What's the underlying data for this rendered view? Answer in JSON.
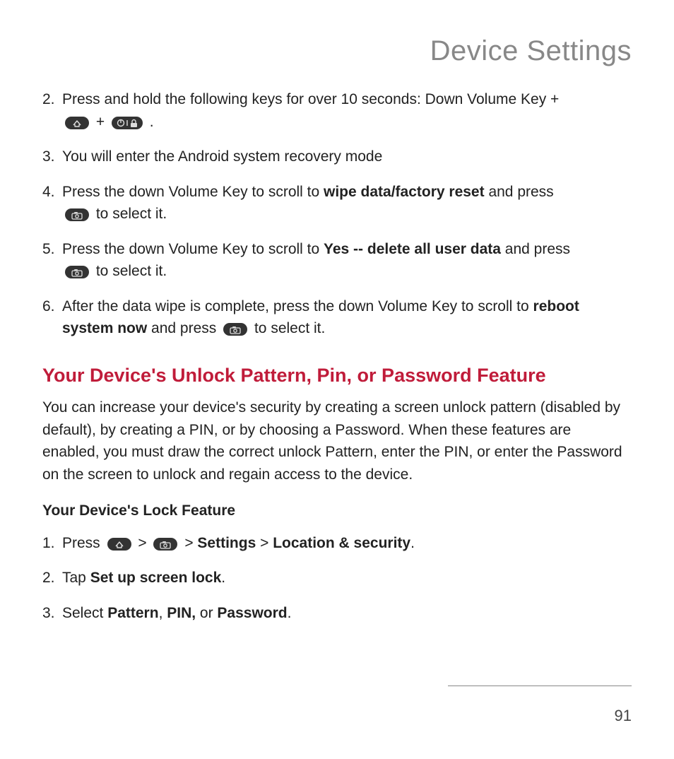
{
  "page_title": "Device Settings",
  "page_number": "91",
  "steps_top": [
    {
      "num": "2.",
      "pre": "Press and hold the following keys for over 10 seconds: Down Volume Key + ",
      "mid": " + ",
      "post": "."
    },
    {
      "num": "3.",
      "text": "You will enter the Android system recovery mode"
    },
    {
      "num": "4.",
      "pre": "Press the down Volume Key to scroll to ",
      "bold": "wipe data/factory reset",
      "post1": " and press ",
      "post2": " to select it."
    },
    {
      "num": "5.",
      "pre": "Press the down Volume Key to scroll to ",
      "bold": "Yes -- delete all user data",
      "post1": " and press ",
      "post2": " to select it."
    },
    {
      "num": "6.",
      "pre": "After the data wipe is complete, press the down Volume Key to scroll to ",
      "bold": "reboot system now",
      "post1": " and press ",
      "post2": " to select it."
    }
  ],
  "section_heading": "Your Device's Unlock Pattern, Pin, or Password Feature",
  "section_para": "You can increase your device's security by creating a screen unlock pattern (disabled by default), by creating a PIN, or by choosing a Password. When these features are enabled, you must draw the correct unlock Pattern, enter the PIN, or enter the Password on the screen to unlock and regain access to the device.",
  "subheading": "Your Device's Lock Feature",
  "steps_bottom": [
    {
      "num": "1.",
      "pre": "Press ",
      "sep1": "  >  ",
      "sep2": "  > ",
      "bold1": "Settings",
      "sep3": " > ",
      "bold2": "Location & security",
      "post": "."
    },
    {
      "num": "2.",
      "pre": "Tap ",
      "bold": "Set up screen lock",
      "post": "."
    },
    {
      "num": "3.",
      "pre": "Select ",
      "bold1": "Pattern",
      "sep1": ", ",
      "bold2": "PIN,",
      "sep2": " or ",
      "bold3": "Password",
      "post": "."
    }
  ]
}
